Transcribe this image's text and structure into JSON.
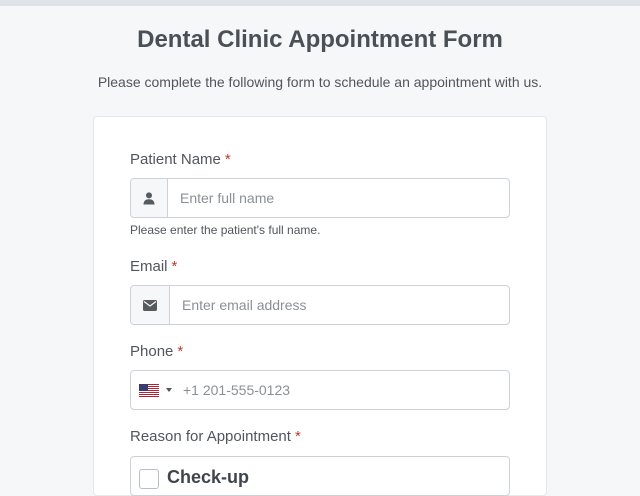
{
  "header": {
    "title": "Dental Clinic Appointment Form",
    "subtitle": "Please complete the following form to schedule an appointment with us."
  },
  "form": {
    "required_marker": "*",
    "patient_name": {
      "label": "Patient Name",
      "placeholder": "Enter full name",
      "value": "",
      "help": "Please enter the patient's full name.",
      "icon": "user-icon"
    },
    "email": {
      "label": "Email",
      "placeholder": "Enter email address",
      "value": "",
      "icon": "envelope-icon"
    },
    "phone": {
      "label": "Phone",
      "placeholder": "+1 201-555-0123",
      "value": "",
      "country_icon": "us-flag-icon"
    },
    "reason": {
      "label": "Reason for Appointment",
      "options": [
        {
          "label": "Check-up",
          "checked": false
        }
      ]
    }
  },
  "colors": {
    "background": "#f5f7f9",
    "required": "#c0392b",
    "border": "#ccd2d7"
  }
}
